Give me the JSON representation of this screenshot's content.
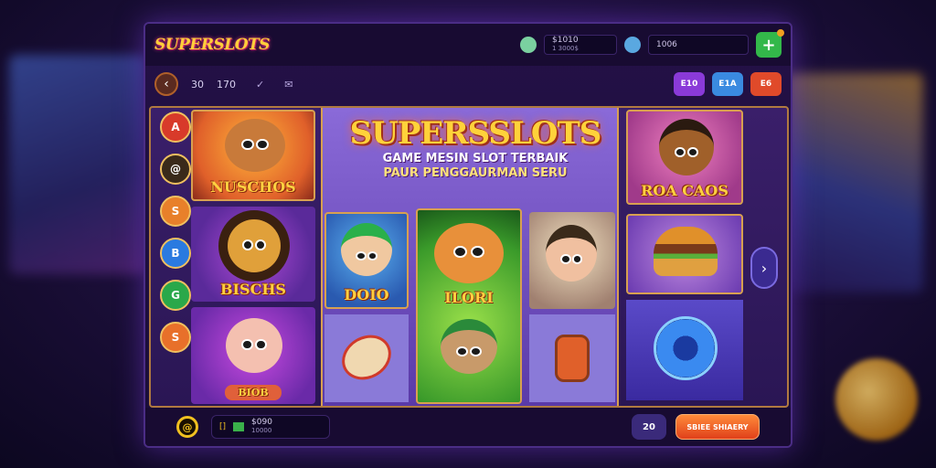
{
  "app": {
    "logo": "SUPERSLOTS"
  },
  "topbar": {
    "balance_value": "$1010",
    "balance_sub": "1 3000$",
    "second_value": "1006"
  },
  "nav": {
    "num_a": "30",
    "num_b": "170",
    "btn_a": "E10",
    "btn_b": "E1A",
    "btn_c": "E6"
  },
  "hero": {
    "title": "SUPERSSLOTS",
    "line1": "GAME MESIN SLOT TERBAIK",
    "line2": "PAUR PENGGAURMAN SERU"
  },
  "cards": {
    "lion_top": "NUSCHOS",
    "lion_mid": "BISCHS",
    "pig": "BIOB",
    "boy": "DOIO",
    "cat": "ILORI",
    "girl_top": "ROA CAOS"
  },
  "side_icons": [
    "A",
    "@",
    "S",
    "B",
    "G",
    "S"
  ],
  "bottombar": {
    "coin_glyph": "@",
    "box_glyph": "[]",
    "value": "$090",
    "value_sub": "10000",
    "small_btn": "20",
    "cta": "SBIEE SHIAERY"
  },
  "colors": {
    "accent": "#ffd23a",
    "panel_border": "#d8a050",
    "cta": "#e0401a"
  }
}
